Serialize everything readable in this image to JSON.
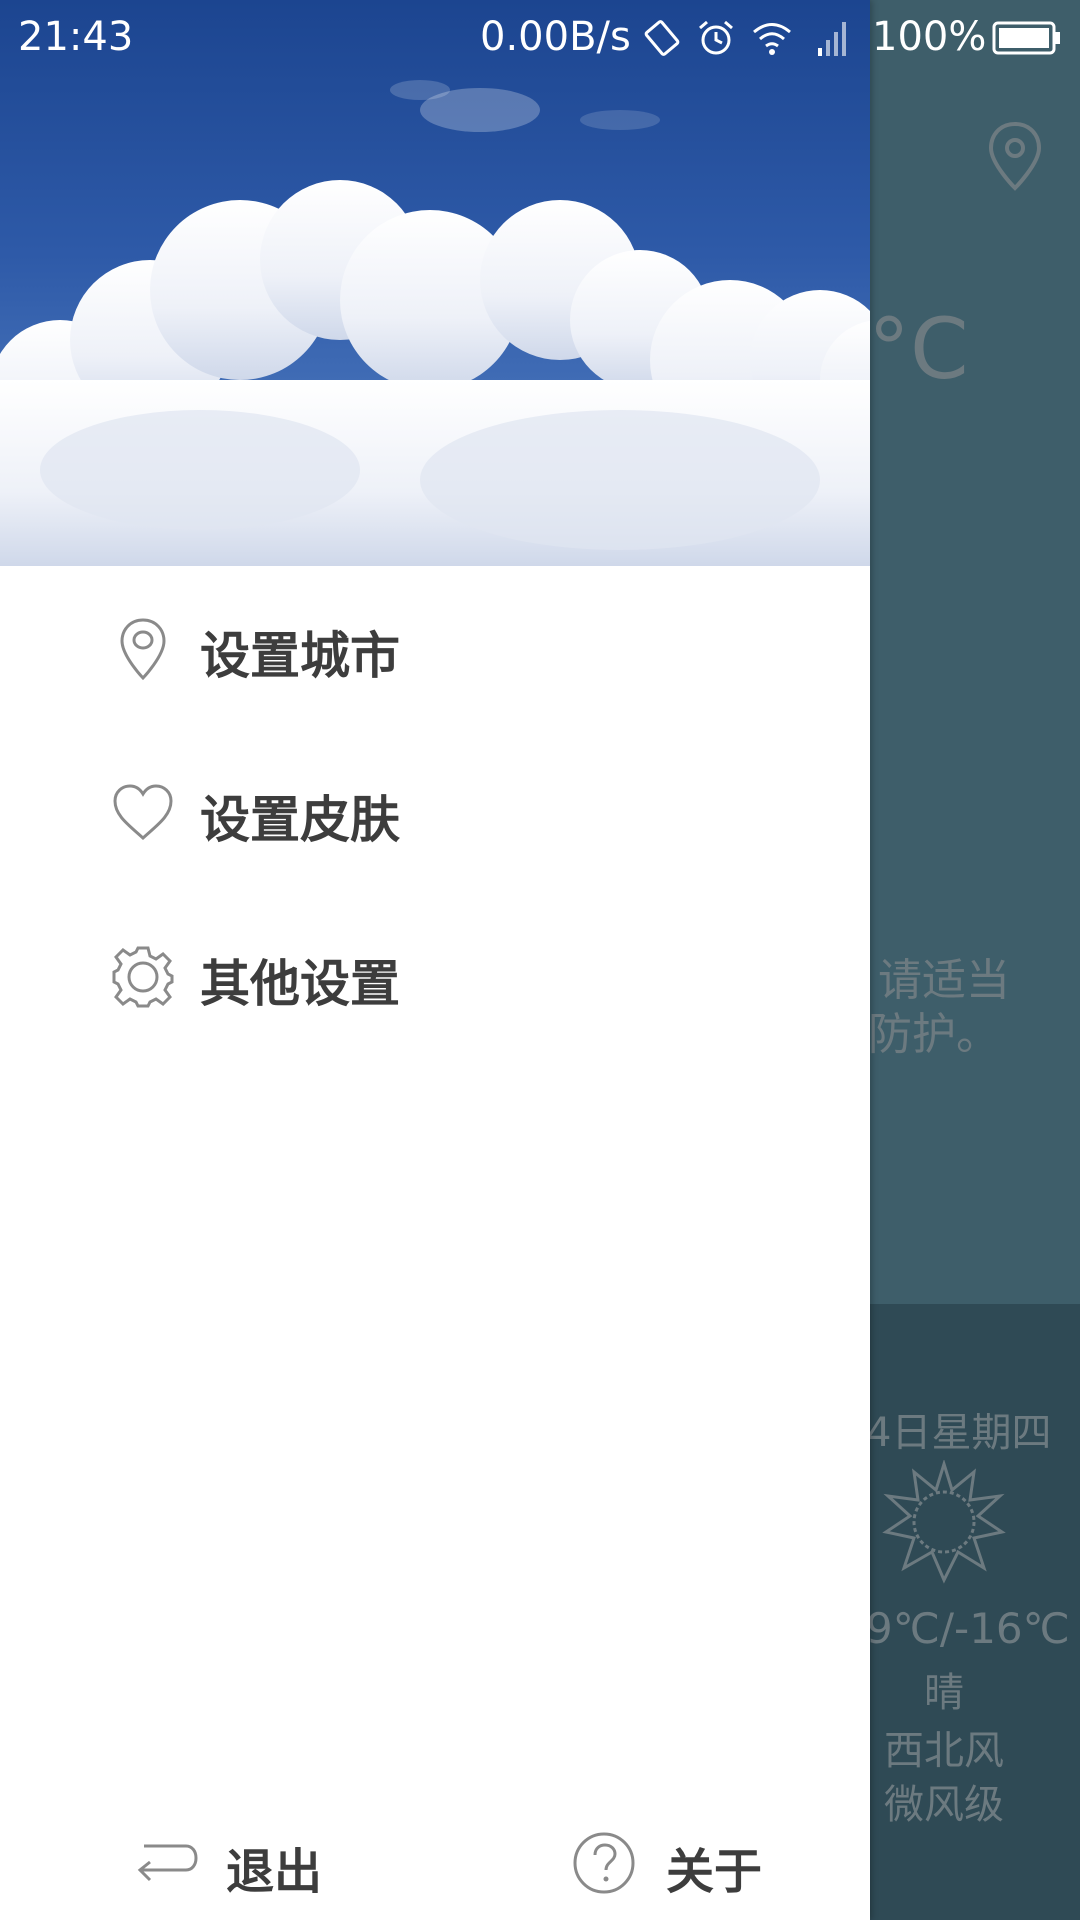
{
  "status_bar": {
    "time": "21:43",
    "network_speed": "0.00B/s",
    "battery": "100%",
    "icons": [
      "rotate-icon",
      "alarm-icon",
      "wifi-icon",
      "signal-icon",
      "battery-icon"
    ]
  },
  "drawer": {
    "menu": [
      {
        "label": "设置城市",
        "icon": "location-pin-icon"
      },
      {
        "label": "设置皮肤",
        "icon": "heart-icon"
      },
      {
        "label": "其他设置",
        "icon": "gear-icon"
      }
    ],
    "footer": {
      "exit_label": "退出",
      "exit_icon": "return-arrow-icon",
      "about_label": "关于",
      "about_icon": "question-circle-icon"
    }
  },
  "background_app": {
    "temperature_unit": "°C",
    "advice_line1": "请适当",
    "advice_line2": "防护。",
    "date": "4日星期四",
    "temp_range": "9℃/-16℃",
    "weather": "晴",
    "wind_direction": "西北风",
    "wind_level": "微风级"
  },
  "colors": {
    "sky_top": "#1f4a9a",
    "sky_bottom": "#4a78c0",
    "overlay": "#3e5e6a",
    "menu_text": "#3d3d3d",
    "icon_stroke": "#8a8a8a"
  }
}
